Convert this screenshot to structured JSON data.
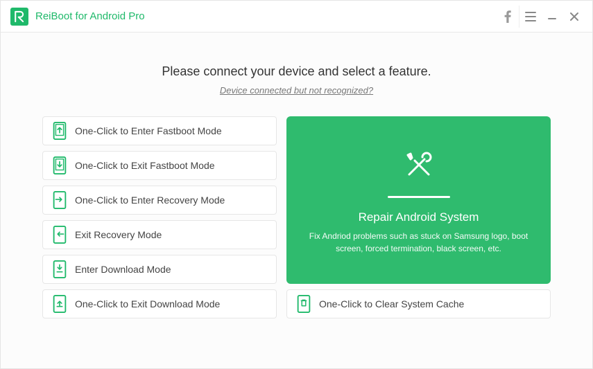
{
  "app": {
    "title": "ReiBoot for Android Pro"
  },
  "prompt": "Please connect your device and select a feature.",
  "helplink": "Device connected but not recognized?",
  "features": {
    "enter_fastboot": "One-Click to Enter Fastboot Mode",
    "exit_fastboot": "One-Click to Exit Fastboot Mode",
    "enter_recovery": "One-Click to Enter Recovery Mode",
    "exit_recovery": "Exit Recovery Mode",
    "enter_download": "Enter Download Mode",
    "exit_download": "One-Click to Exit Download Mode",
    "clear_cache": "One-Click to Clear System Cache"
  },
  "repair": {
    "title": "Repair Android System",
    "desc": "Fix Andriod problems such as stuck on Samsung logo, boot screen, forced termination, black screen, etc."
  },
  "colors": {
    "accent": "#1fb96a",
    "card": "#2fbb6e"
  }
}
